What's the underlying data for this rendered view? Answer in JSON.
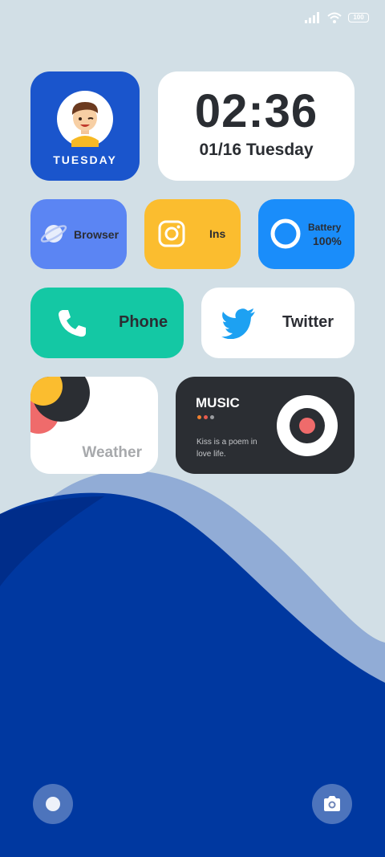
{
  "status_bar": {
    "battery_level": "100",
    "signal_icon": "signal-icon",
    "wifi_icon": "wifi-icon"
  },
  "profile_widget": {
    "day": "TUESDAY",
    "avatar_icon": "avatar-icon"
  },
  "clock_widget": {
    "time": "02:36",
    "date": "01/16 Tuesday"
  },
  "apps": {
    "browser": {
      "label": "Browser",
      "icon": "planet-icon"
    },
    "ins": {
      "label": "Ins",
      "icon": "instagram-icon"
    },
    "battery": {
      "label": "Battery",
      "value": "100%",
      "level": 1.0,
      "icon": "battery-ring-icon"
    },
    "phone": {
      "label": "Phone",
      "icon": "phone-icon"
    },
    "twitter": {
      "label": "Twitter",
      "icon": "twitter-bird-icon"
    }
  },
  "weather_widget": {
    "label": "Weather"
  },
  "music_widget": {
    "title": "MUSIC",
    "lyric": "Kiss is a poem in love life.",
    "dot_colors": [
      "#f0812f",
      "#e85a4f",
      "#9a9ca0"
    ]
  },
  "dock": {
    "left_icon": "circle-icon",
    "right_icon": "camera-icon"
  },
  "colors": {
    "wallpaper_light": "#d2dfe6",
    "wave_dark": "#0038a0",
    "wave_light": "#91acd6"
  }
}
